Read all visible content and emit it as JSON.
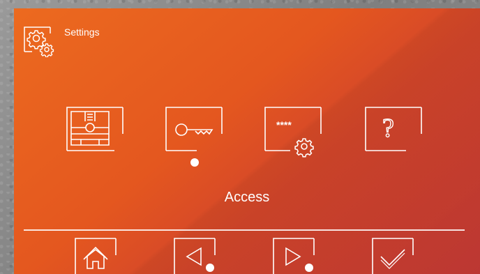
{
  "header": {
    "title": "Settings",
    "icon": "settings-gear-icon"
  },
  "menu": {
    "items": [
      {
        "name": "video-intercom",
        "icon": "video-intercom-icon"
      },
      {
        "name": "access",
        "icon": "key-icon"
      },
      {
        "name": "password-settings",
        "icon": "password-icon",
        "mask_text": "****"
      },
      {
        "name": "help",
        "icon": "help-icon"
      }
    ],
    "selected_label": "Access"
  },
  "bottom_bar": {
    "items": [
      {
        "name": "home",
        "icon": "home-icon"
      },
      {
        "name": "previous",
        "icon": "left-arrow-icon"
      },
      {
        "name": "next",
        "icon": "right-arrow-icon"
      },
      {
        "name": "confirm",
        "icon": "check-icon"
      }
    ]
  },
  "colors": {
    "background_start": "#ec6a1f",
    "background_end": "#c83a36",
    "foreground": "#ffffff"
  }
}
